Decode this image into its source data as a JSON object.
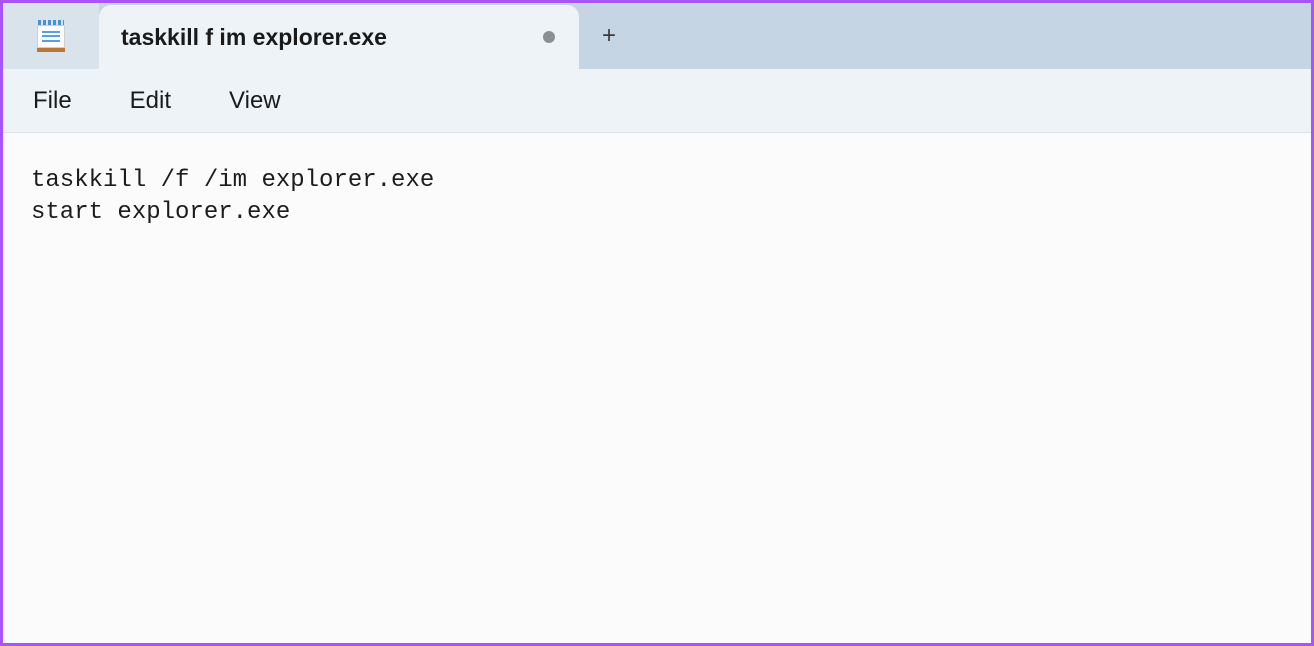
{
  "tab": {
    "title": "taskkill f im explorer.exe"
  },
  "menu": {
    "file": "File",
    "edit": "Edit",
    "view": "View"
  },
  "editor": {
    "content": "taskkill /f /im explorer.exe\nstart explorer.exe"
  }
}
